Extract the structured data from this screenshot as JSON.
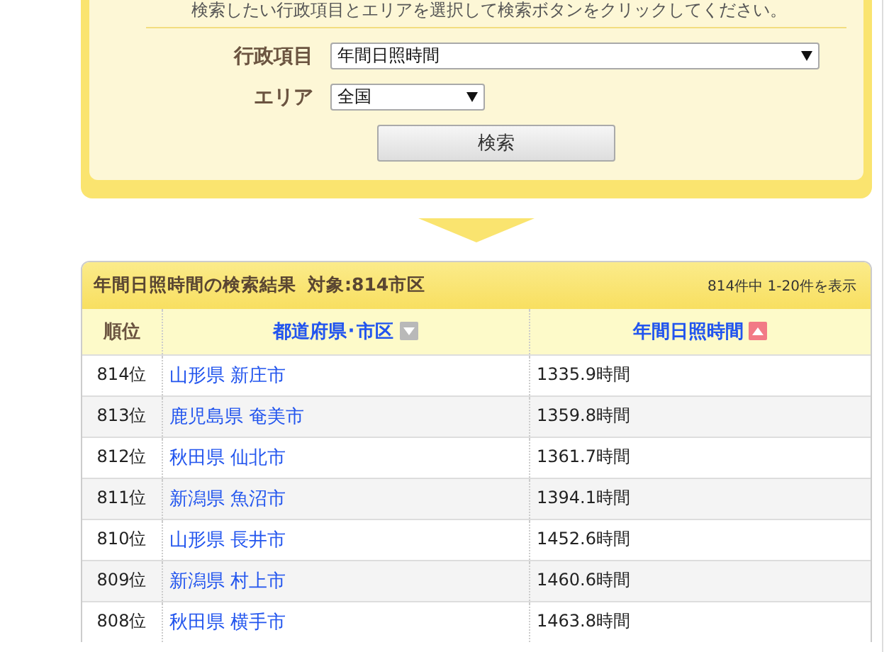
{
  "search_panel": {
    "instruction": "検索したい行政項目とエリアを選択して検索ボタンをクリックしてください。",
    "fields": [
      {
        "label": "行政項目",
        "value": "年間日照時間"
      },
      {
        "label": "エリア",
        "value": "全国"
      }
    ],
    "button": "検索"
  },
  "results": {
    "title": "年間日照時間の検索結果",
    "target": "対象:814市区",
    "count": "814件中 1-20件を表示",
    "columns": [
      {
        "label": "順位",
        "sortable": false
      },
      {
        "label": "都道府県･市区",
        "sortable": true,
        "sort_active": false,
        "ascending": false
      },
      {
        "label": "年間日照時間",
        "sortable": true,
        "sort_active": true,
        "ascending": true
      }
    ],
    "rows": [
      {
        "rank": "814位",
        "city": "山形県 新庄市",
        "hours": "1335.9時間"
      },
      {
        "rank": "813位",
        "city": "鹿児島県 奄美市",
        "hours": "1359.8時間"
      },
      {
        "rank": "812位",
        "city": "秋田県 仙北市",
        "hours": "1361.7時間"
      },
      {
        "rank": "811位",
        "city": "新潟県 魚沼市",
        "hours": "1394.1時間"
      },
      {
        "rank": "810位",
        "city": "山形県 長井市",
        "hours": "1452.6時間"
      },
      {
        "rank": "809位",
        "city": "新潟県 村上市",
        "hours": "1460.6時間"
      },
      {
        "rank": "808位",
        "city": "秋田県 横手市",
        "hours": "1463.8時間"
      }
    ]
  }
}
